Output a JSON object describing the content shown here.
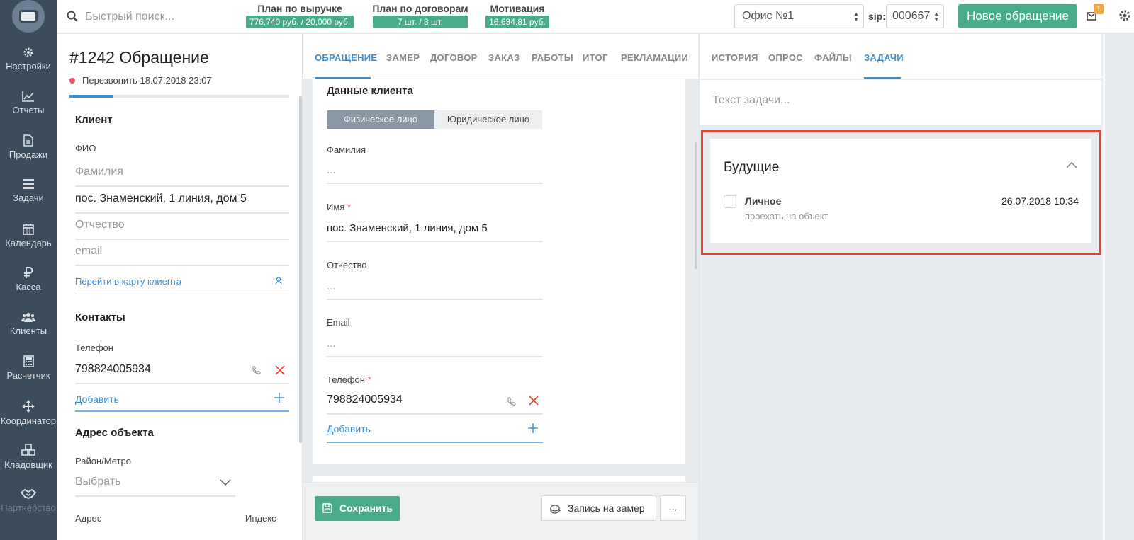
{
  "sidebar": {
    "items": [
      {
        "label": "Настройки",
        "icon": "gear-icon"
      },
      {
        "label": "Отчеты",
        "icon": "chart-line-icon"
      },
      {
        "label": "Продажи",
        "icon": "document-icon"
      },
      {
        "label": "Задачи",
        "icon": "tasks-icon"
      },
      {
        "label": "Календарь",
        "icon": "calendar-icon"
      },
      {
        "label": "Касса",
        "icon": "ruble-icon"
      },
      {
        "label": "Клиенты",
        "icon": "users-icon"
      },
      {
        "label": "Расчетчик",
        "icon": "calculator-icon"
      },
      {
        "label": "Координатор",
        "icon": "arrows-icon"
      },
      {
        "label": "Кладовщик",
        "icon": "cubes-icon"
      },
      {
        "label": "Партнерство",
        "icon": "handshake-icon"
      }
    ]
  },
  "topbar": {
    "search_placeholder": "Быстрый поиск...",
    "plans": [
      {
        "label": "План по выручке",
        "value": "776,740 руб. / 20,000 руб."
      },
      {
        "label": "План по договорам",
        "value": "7 шт. / 3 шт."
      },
      {
        "label": "Мотивация",
        "value": "16,634.81 руб."
      }
    ],
    "office": "Офис №1",
    "sip_label": "sip:",
    "sip_value": "000667",
    "new_request_label": "Новое обращение",
    "mail_count": "1"
  },
  "left": {
    "title": "#1242 Обращение",
    "callback": "Перезвонить 18.07.2018 23:07",
    "progress": 0.2,
    "client_section": "Клиент",
    "fio_label": "ФИО",
    "surname_placeholder": "Фамилия",
    "name_value": "пос. Знаменский, 1 линия, дом 5",
    "patronymic_placeholder": "Отчество",
    "email_placeholder": "email",
    "client_card_link": "Перейти в карту клиента",
    "contacts_section": "Контакты",
    "phone_label": "Телефон",
    "phone_value": "798824005934",
    "add_label": "Добавить",
    "address_section": "Адрес объекта",
    "district_label": "Район/Метро",
    "district_placeholder": "Выбрать",
    "address_label": "Адрес",
    "index_label": "Индекс"
  },
  "middle": {
    "tabs": [
      "ОБРАЩЕНИЕ",
      "ЗАМЕР",
      "ДОГОВОР",
      "ЗАКАЗ",
      "РАБОТЫ",
      "ИТОГ",
      "РЕКЛАМАЦИИ"
    ],
    "active_tab": "ОБРАЩЕНИЕ",
    "card_title": "Данные клиента",
    "seg_individual": "Физическое лицо",
    "seg_legal": "Юридическое лицо",
    "surname_label": "Фамилия",
    "surname_placeholder": "...",
    "name_label": "Имя",
    "required_mark": "*",
    "name_value": "пос. Знаменский, 1 линия, дом 5",
    "patronymic_label": "Отчество",
    "patronymic_placeholder": "...",
    "email_label": "Email",
    "email_placeholder": "...",
    "phone_label": "Телефон",
    "phone_value": "798824005934",
    "add_label": "Добавить",
    "save_label": "Сохранить",
    "measure_label": "Запись на замер",
    "more_label": "..."
  },
  "right": {
    "tabs": [
      "ИСТОРИЯ",
      "ОПРОС",
      "ФАЙЛЫ",
      "ЗАДАЧИ"
    ],
    "active_tab": "ЗАДАЧИ",
    "task_placeholder": "Текст задачи...",
    "future_title": "Будущие",
    "task": {
      "title": "Личное",
      "description": "проехать на объект",
      "date": "26.07.2018 10:34"
    }
  },
  "colors": {
    "sidebar_bg": "#3b4c5c",
    "accent_green": "#4aab8c",
    "accent_blue": "#3b8fd6",
    "highlight_red": "#e0432f",
    "required_red": "#e25563",
    "badge_orange": "#f0a63c"
  }
}
